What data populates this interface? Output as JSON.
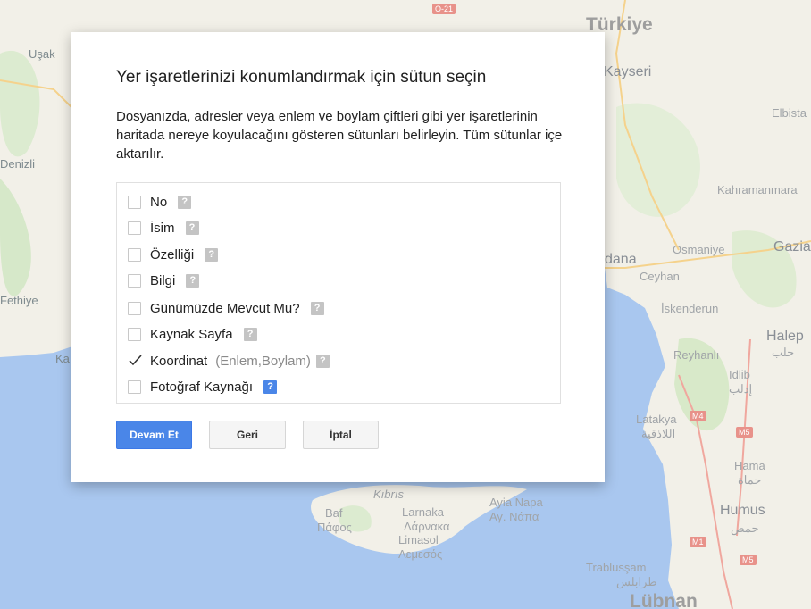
{
  "map": {
    "labels": {
      "turkiye": "Türkiye",
      "kayseri": "Kayseri",
      "elbistan": "Elbista",
      "usak": "Uşak",
      "denizli": "Denizli",
      "kahramanmaras": "Kahramanmara",
      "gaziantep": "Gazia",
      "adana": "dana",
      "osmaniye": "Osmaniye",
      "ceyhan": "Ceyhan",
      "fethiye": "Fethiye",
      "iskenderun": "İskenderun",
      "halep": "Halep",
      "halep_ar": "حلب",
      "kas": "Ka",
      "reyhanli": "Reyhanlı",
      "idlib": "Idlib",
      "idlib_ar": "إدلب",
      "latakya": "Latakya",
      "latakya_ar": "اللاذقية",
      "hama": "Hama",
      "hama_ar": "حماة",
      "kibris": "Kıbrıs",
      "baf": "Baf",
      "baf_gr": "Πάφος",
      "larnaka": "Larnaka",
      "larnaka_gr": "Λάρνακα",
      "ayia_napa": "Ayia Napa",
      "ayia_napa_gr": "Αγ. Νάπα",
      "limasol": "Limasol",
      "limasol_gr": "Λεμεσός",
      "humus": "Humus",
      "humus_ar": "حمص",
      "trablussam": "Trablusşam",
      "trablussam_ar": "طرابلس",
      "lubnan": "Lübnan",
      "cyprus_big": "KIBRIS"
    },
    "roads": [
      "O-21",
      "M4",
      "M5",
      "M1",
      "M5"
    ]
  },
  "dialog": {
    "title": "Yer işaretlerinizi konumlandırmak için sütun seçin",
    "description": "Dosyanızda, adresler veya enlem ve boylam çiftleri gibi yer işaretlerinin haritada nereye koyulacağını gösteren sütunları belirleyin. Tüm sütunlar içe aktarılır.",
    "help_glyph": "?",
    "columns": [
      {
        "name": "No",
        "hint": "",
        "checked": false
      },
      {
        "name": "İsim",
        "hint": "",
        "checked": false
      },
      {
        "name": "Özelliği",
        "hint": "",
        "checked": false
      },
      {
        "name": "Bilgi",
        "hint": "",
        "checked": false
      },
      {
        "name": "Günümüzde Mevcut Mu?",
        "hint": "",
        "checked": false
      },
      {
        "name": "Kaynak Sayfa",
        "hint": "",
        "checked": false
      },
      {
        "name": "Koordinat",
        "hint": "(Enlem,Boylam)",
        "checked": true
      },
      {
        "name": "Fotoğraf Kaynağı",
        "hint": "",
        "checked": false
      }
    ],
    "buttons": {
      "continue": "Devam Et",
      "back": "Geri",
      "cancel": "İptal"
    }
  },
  "colors": {
    "primary": "#4a86e8",
    "land": "#f3f1ea",
    "sea": "#aac8f0"
  }
}
